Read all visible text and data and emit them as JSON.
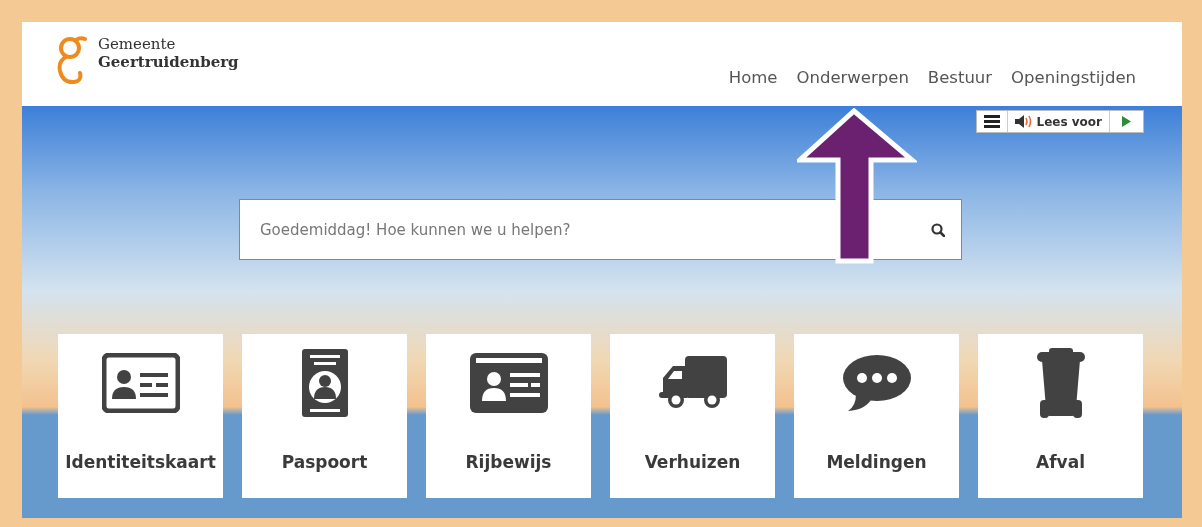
{
  "logo": {
    "line_1": "Gemeente",
    "line_2": "Geertruidenberg"
  },
  "nav": [
    {
      "label": "Home"
    },
    {
      "label": "Onderwerpen"
    },
    {
      "label": "Bestuur"
    },
    {
      "label": "Openingstijden"
    }
  ],
  "read_aloud": {
    "label": "Lees voor"
  },
  "search": {
    "placeholder": "Goedemiddag! Hoe kunnen we u helpen?"
  },
  "tiles": [
    {
      "label": "Identiteitskaart",
      "kind": "idcard"
    },
    {
      "label": "Paspoort",
      "kind": "passport"
    },
    {
      "label": "Rijbewijs",
      "kind": "license"
    },
    {
      "label": "Verhuizen",
      "kind": "truck"
    },
    {
      "label": "Meldingen",
      "kind": "chat"
    },
    {
      "label": "Afval",
      "kind": "bin"
    }
  ]
}
